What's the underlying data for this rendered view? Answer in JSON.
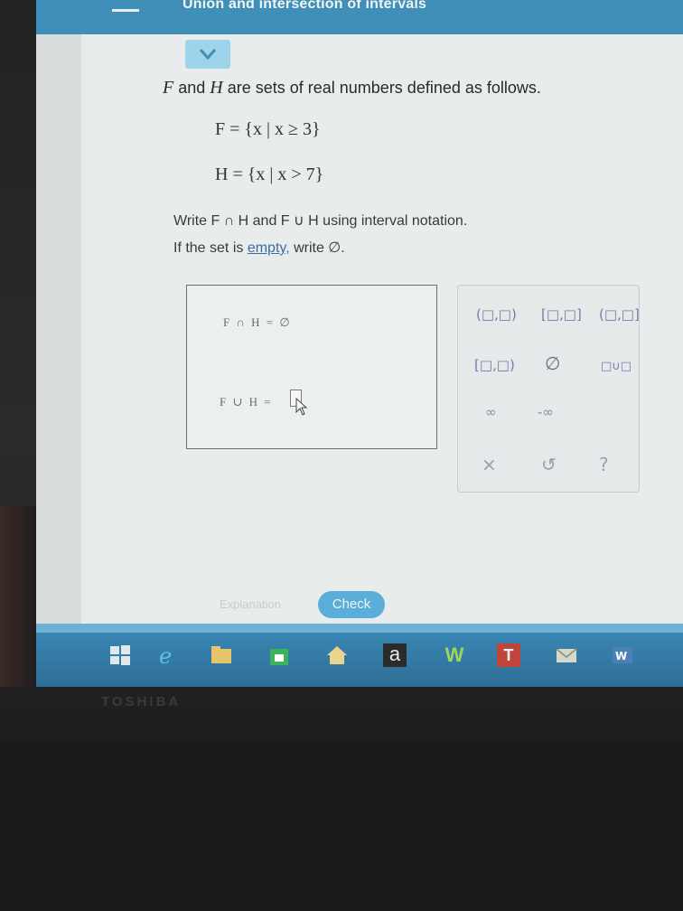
{
  "header": {
    "title": "Union and intersection of intervals"
  },
  "problem": {
    "intro_pre": "F",
    "intro_mid": " and ",
    "intro_h": "H",
    "intro_post": " are sets of real numbers defined as follows.",
    "set_f": "F = {x | x ≥ 3}",
    "set_h": "H = {x | x > 7}",
    "instruction_1": "Write F ∩ H and F ∪ H using interval notation.",
    "instruction_1_link": "interval",
    "instruction_2_pre": "If the set is ",
    "instruction_2_link": "empty,",
    "instruction_2_post": " write ∅."
  },
  "answers": {
    "intersection": "F ∩ H = ∅",
    "union_label": "F ∪ H ="
  },
  "keypad": {
    "row1": [
      "(□,□)",
      "[□,□]",
      "(□,□]"
    ],
    "row2": [
      "[□,□)",
      "∅",
      "□∪□"
    ],
    "row3": [
      "∞",
      "-∞"
    ],
    "row4": [
      "×",
      "↺",
      "?"
    ]
  },
  "buttons": {
    "explanation": "Explanation",
    "check": "Check"
  },
  "taskbar": {
    "letter_a": "a",
    "letter_t": "T",
    "letter_w": "W"
  },
  "device": {
    "brand": "TOSHIBA"
  },
  "colors": {
    "header": "#3f8fb8",
    "check_button": "#5aaed9",
    "keypad_text": "#6d7fa8"
  }
}
